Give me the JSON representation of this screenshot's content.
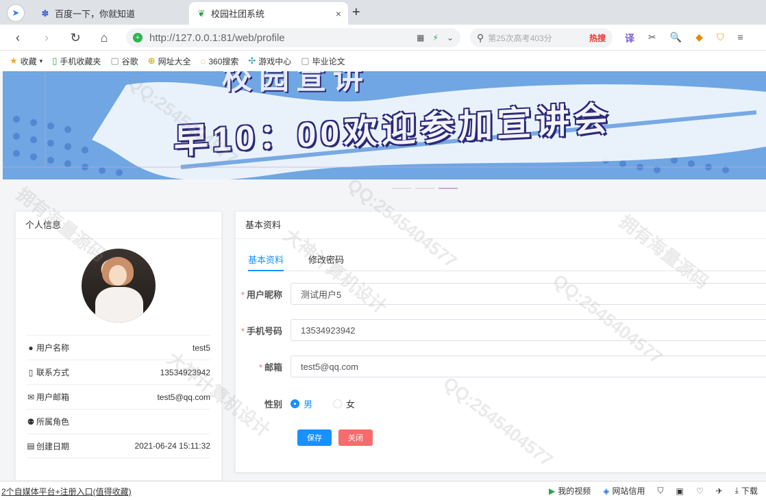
{
  "browser": {
    "tabs": [
      {
        "label": "百度一下，你就知道",
        "icon": "paw-icon"
      },
      {
        "label": "校园社团系统",
        "icon": "leaf-icon",
        "active": true
      }
    ],
    "new_tab": "+",
    "close": "×",
    "url": "http://127.0.0.1:81/web/profile",
    "search_placeholder": "第25次高考403分",
    "search_hot": "热搜",
    "bookmarks": [
      {
        "label": "收藏",
        "icon": "star-icon"
      },
      {
        "label": "手机收藏夹",
        "icon": "phone-icon"
      },
      {
        "label": "谷歌",
        "icon": "document-icon"
      },
      {
        "label": "网址大全",
        "icon": "globe-icon"
      },
      {
        "label": "360搜索",
        "icon": "search-icon"
      },
      {
        "label": "游戏中心",
        "icon": "gamepad-icon"
      },
      {
        "label": "毕业论文",
        "icon": "document-icon"
      }
    ],
    "status_link": "2个自媒体平台+注册入口(值得收藏)",
    "status_items": [
      {
        "label": "我的视频",
        "icon": "video-icon"
      },
      {
        "label": "网站信用",
        "icon": "drop-icon"
      },
      {
        "label": "下载",
        "icon": "download-icon"
      }
    ]
  },
  "banner": {
    "line1": "校园宣讲",
    "line2": "早10：00欢迎参加宣讲会",
    "colors": {
      "bg": "#6fa6e3",
      "text_outline": "#2b2a78"
    }
  },
  "profile_card": {
    "title": "个人信息",
    "rows": [
      {
        "icon": "user-icon",
        "label": "用户名称",
        "value": "test5"
      },
      {
        "icon": "mobile-icon",
        "label": "联系方式",
        "value": "13534923942"
      },
      {
        "icon": "mail-icon",
        "label": "用户邮箱",
        "value": "test5@qq.com"
      },
      {
        "icon": "group-icon",
        "label": "所属角色",
        "value": ""
      },
      {
        "icon": "calendar-icon",
        "label": "创建日期",
        "value": "2021-06-24 15:11:32"
      }
    ]
  },
  "form_card": {
    "title": "基本资料",
    "tabs": [
      {
        "label": "基本资料",
        "active": true
      },
      {
        "label": "修改密码",
        "active": false
      }
    ],
    "fields": [
      {
        "label": "用户昵称",
        "required": true,
        "value": "测试用户5"
      },
      {
        "label": "手机号码",
        "required": true,
        "value": "13534923942"
      },
      {
        "label": "邮箱",
        "required": true,
        "value": "test5@qq.com"
      }
    ],
    "gender": {
      "label": "性别",
      "options": [
        {
          "label": "男",
          "selected": true
        },
        {
          "label": "女",
          "selected": false
        }
      ]
    },
    "buttons": {
      "save": "保存",
      "close": "关闭"
    },
    "colors": {
      "primary": "#1890ff",
      "danger": "#f56c6c"
    }
  },
  "watermarks": {
    "qq": "QQ:2545404577",
    "design": "大神计算机设计",
    "source": "拥有海量源码"
  }
}
